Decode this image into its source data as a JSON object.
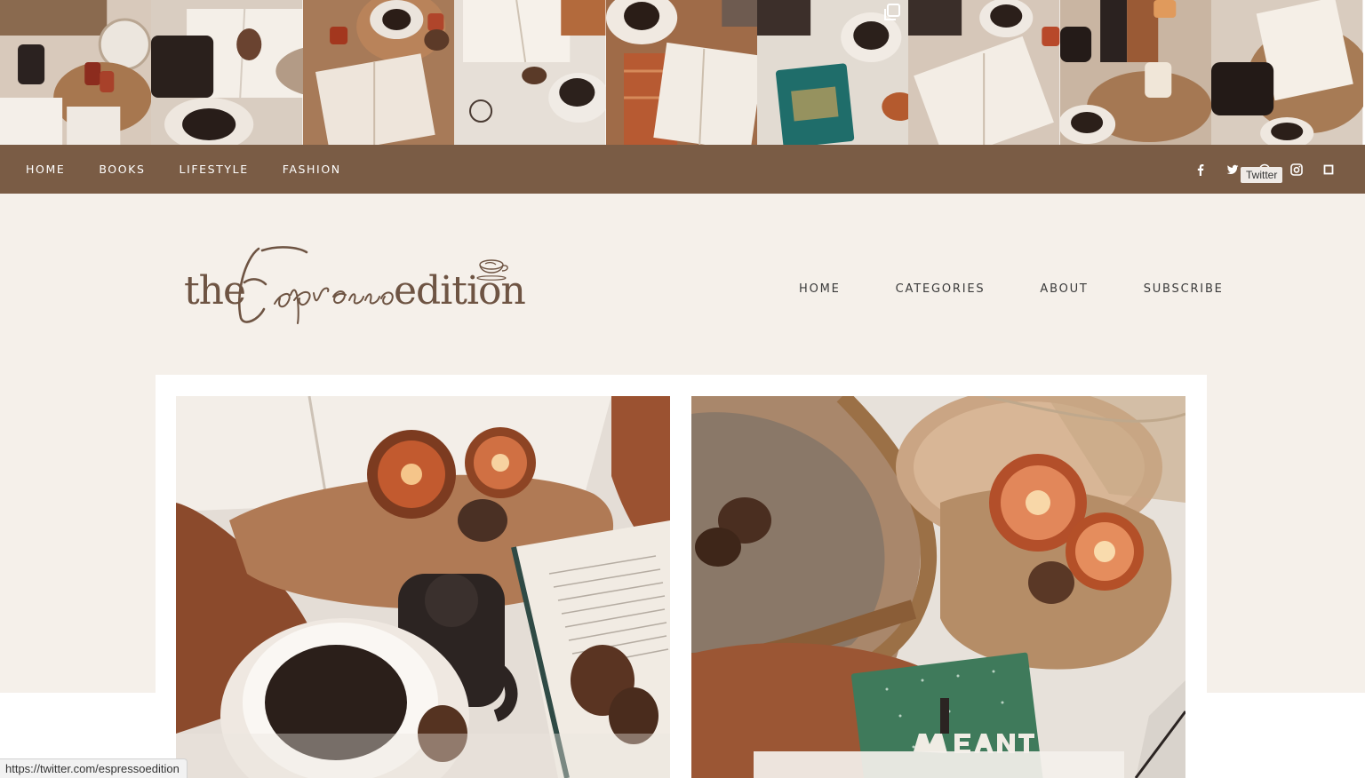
{
  "top_nav": {
    "items": [
      "HOME",
      "BOOKS",
      "LIFESTYLE",
      "FASHION"
    ]
  },
  "social": {
    "icons": [
      "facebook-icon",
      "twitter-icon",
      "pinterest-icon",
      "instagram-icon",
      "bloglovin-icon"
    ],
    "tooltip": "Twitter"
  },
  "logo": {
    "part1": "the",
    "script": "Espresso",
    "part2": "edition"
  },
  "main_nav": {
    "items": [
      "HOME",
      "CATEGORIES",
      "ABOUT",
      "SUBSCRIBE"
    ]
  },
  "status_bar": {
    "url": "https://twitter.com/espressoedition"
  },
  "colors": {
    "nav_bar": "#7a5c45",
    "header_bg": "#f5f0ea",
    "logo": "#6e5443"
  },
  "instagram_tiles": 9
}
